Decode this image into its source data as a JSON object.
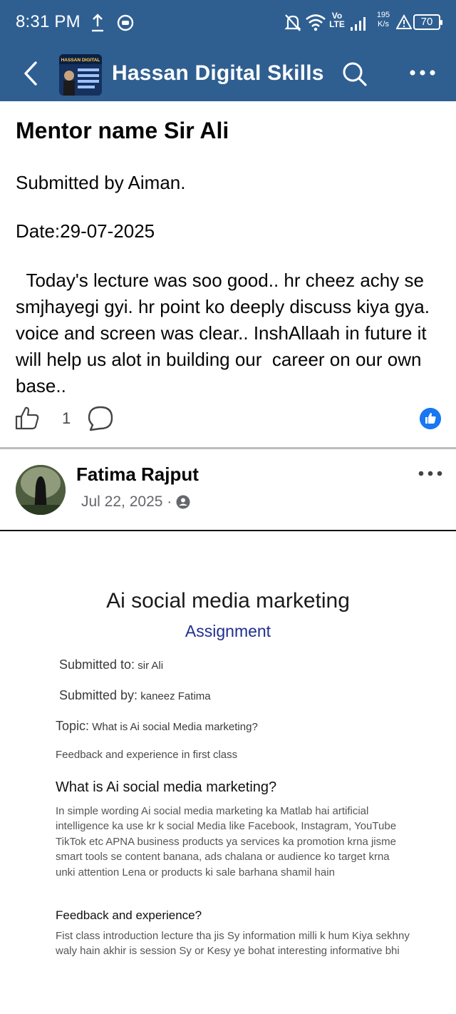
{
  "status_bar": {
    "time": "8:31 PM",
    "network_top": "Vo",
    "network_bottom": "LTE",
    "speed_top": "195",
    "speed_bottom": "K/s",
    "battery": "70"
  },
  "header": {
    "group_name": "Hassan Digital Skills",
    "avatar_text": "HASSAN DIGITAL"
  },
  "post1": {
    "mentor": "Mentor name Sir Ali",
    "submitted_by": "Submitted by Aiman.",
    "date": "Date:29-07-2025",
    "body": "  Today's lecture was soo good.. hr cheez achy se smjhayegi gyi. hr point ko deeply discuss kiya gya. voice and screen was clear.. InshAllaah in future it will help us alot in building our  career on our own base..",
    "like_count": "1"
  },
  "post2": {
    "author": "Fatima Rajput",
    "date": "Jul 22, 2025 ·",
    "document": {
      "title": "Ai social media marketing",
      "subtitle": "Assignment",
      "submitted_to_label": "Submitted to:",
      "submitted_to_value": " sir Ali",
      "submitted_by_label": "Submitted by:",
      "submitted_by_value": " kaneez Fatima",
      "topic_label": "Topic:",
      "topic_value": " What is Ai social Media marketing?",
      "feedback_first": "Feedback and experience in first class",
      "heading_what": "What is Ai social media marketing?",
      "para_what": "In simple wording Ai social media marketing ka Matlab hai artificial intelligence ka use kr k social Media like Facebook, Instagram, YouTube TikTok etc APNA business products ya services ka promotion krna jisme smart tools se content banana, ads chalana or audience ko target krna unki attention Lena or products ki sale barhana shamil hain",
      "heading_feedback": "Feedback and experience?",
      "para_feedback": "Fist class introduction lecture tha jis Sy information milli k hum Kiya sekhny waly hain akhir is session Sy or Kesy ye bohat interesting informative bhi"
    }
  },
  "colors": {
    "header_bg": "#2f5f91",
    "like_blue": "#1877f2",
    "assignment_blue": "#1f2f8f"
  }
}
